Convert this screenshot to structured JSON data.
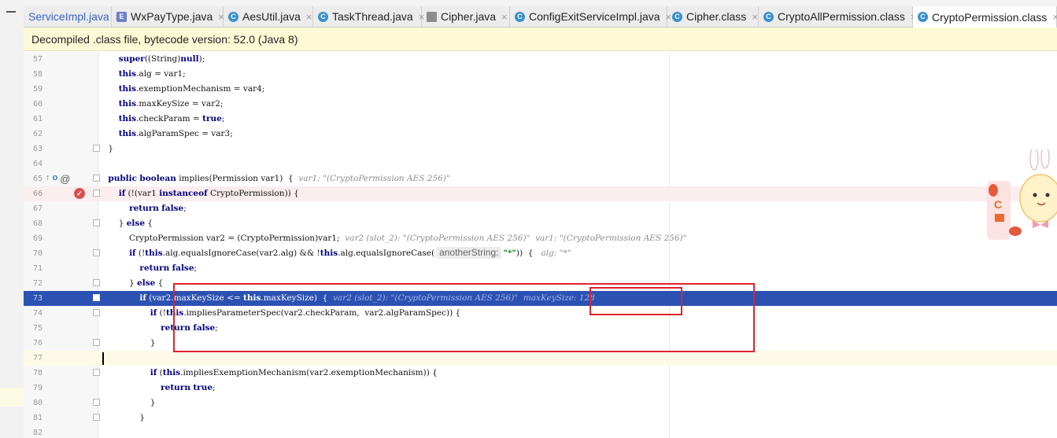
{
  "tabs": [
    {
      "label": "ServiceImpl.java",
      "icon": "c",
      "active": false,
      "blue": true
    },
    {
      "label": "WxPayType.java",
      "icon": "e",
      "active": false
    },
    {
      "label": "AesUtil.java",
      "icon": "c",
      "active": false
    },
    {
      "label": "TaskThread.java",
      "icon": "c",
      "active": false
    },
    {
      "label": "Cipher.java",
      "icon": "doc",
      "active": false
    },
    {
      "label": "ConfigExitServiceImpl.java",
      "icon": "c",
      "active": false
    },
    {
      "label": "Cipher.class",
      "icon": "c",
      "active": false
    },
    {
      "label": "CryptoAllPermission.class",
      "icon": "c",
      "active": false
    },
    {
      "label": "CryptoPermission.class",
      "icon": "c",
      "active": true
    }
  ],
  "tab_close_glyph": "×",
  "banner": "Decompiled .class file, bytecode version: 52.0 (Java 8)",
  "gutter_icons": {
    "up": "↑",
    "override": "o",
    "at": "@",
    "breakpoint": "✓"
  },
  "lines": [
    {
      "n": "57",
      "tokens": [
        {
          "t": "        "
        },
        {
          "t": "super",
          "k": "kw"
        },
        {
          "t": "((String)"
        },
        {
          "t": "null",
          "k": "kw"
        },
        {
          "t": ");"
        }
      ]
    },
    {
      "n": "58",
      "tokens": [
        {
          "t": "        "
        },
        {
          "t": "this",
          "k": "kw"
        },
        {
          "t": ".alg = var1;"
        }
      ]
    },
    {
      "n": "59",
      "tokens": [
        {
          "t": "        "
        },
        {
          "t": "this",
          "k": "kw"
        },
        {
          "t": ".exemptionMechanism = var4;"
        }
      ]
    },
    {
      "n": "60",
      "tokens": [
        {
          "t": "        "
        },
        {
          "t": "this",
          "k": "kw"
        },
        {
          "t": ".maxKeySize = var2;"
        }
      ]
    },
    {
      "n": "61",
      "tokens": [
        {
          "t": "        "
        },
        {
          "t": "this",
          "k": "kw"
        },
        {
          "t": ".checkParam = "
        },
        {
          "t": "true",
          "k": "kw"
        },
        {
          "t": ";"
        }
      ]
    },
    {
      "n": "62",
      "tokens": [
        {
          "t": "        "
        },
        {
          "t": "this",
          "k": "kw"
        },
        {
          "t": ".algParamSpec = var3;"
        }
      ]
    },
    {
      "n": "63",
      "tokens": [
        {
          "t": "    }"
        }
      ],
      "fold": true
    },
    {
      "n": "64",
      "tokens": []
    },
    {
      "n": "65",
      "tokens": [
        {
          "t": "    "
        },
        {
          "t": "public",
          "k": "kw"
        },
        {
          "t": " "
        },
        {
          "t": "boolean",
          "k": "kw"
        },
        {
          "t": " implies(Permission var1)  {  "
        },
        {
          "t": "var1: \"(CryptoPermission AES 256)\"",
          "k": "hint"
        }
      ],
      "fold": true,
      "icons": true
    },
    {
      "n": "66",
      "tokens": [
        {
          "t": "        "
        },
        {
          "t": "if",
          "k": "kw"
        },
        {
          "t": " (!(var1 "
        },
        {
          "t": "instanceof",
          "k": "kw"
        },
        {
          "t": " CryptoPermission)) {"
        }
      ],
      "fold": true,
      "bp": true
    },
    {
      "n": "67",
      "tokens": [
        {
          "t": "            "
        },
        {
          "t": "return",
          "k": "kw"
        },
        {
          "t": " "
        },
        {
          "t": "false",
          "k": "kw"
        },
        {
          "t": ";"
        }
      ]
    },
    {
      "n": "68",
      "tokens": [
        {
          "t": "        } "
        },
        {
          "t": "else",
          "k": "kw"
        },
        {
          "t": " {"
        }
      ],
      "fold": true
    },
    {
      "n": "69",
      "tokens": [
        {
          "t": "            CryptoPermission var2 = (CryptoPermission)var1;  "
        },
        {
          "t": "var2 (slot_2): \"(CryptoPermission AES 256)\"  var1: \"(CryptoPermission AES 256)\"",
          "k": "hint"
        }
      ]
    },
    {
      "n": "70",
      "tokens": [
        {
          "t": "            "
        },
        {
          "t": "if",
          "k": "kw"
        },
        {
          "t": " (!"
        },
        {
          "t": "this",
          "k": "kw"
        },
        {
          "t": ".alg.equalsIgnoreCase(var2.alg) && !"
        },
        {
          "t": "this",
          "k": "kw"
        },
        {
          "t": ".alg.equalsIgnoreCase("
        },
        {
          "t": "anotherString:",
          "k": "pbox"
        },
        {
          "t": "\"*\"",
          "k": "str"
        },
        {
          "t": "))  {   "
        },
        {
          "t": "alg: \"*\"",
          "k": "hint"
        }
      ],
      "fold": true
    },
    {
      "n": "71",
      "tokens": [
        {
          "t": "                "
        },
        {
          "t": "return",
          "k": "kw"
        },
        {
          "t": " "
        },
        {
          "t": "false",
          "k": "kw"
        },
        {
          "t": ";"
        }
      ]
    },
    {
      "n": "72",
      "tokens": [
        {
          "t": "            } "
        },
        {
          "t": "else",
          "k": "kw"
        },
        {
          "t": " {"
        }
      ],
      "fold": true
    },
    {
      "n": "73",
      "tokens": [
        {
          "t": "                "
        },
        {
          "t": "if",
          "k": "kw"
        },
        {
          "t": " (var2.maxKeySize <= "
        },
        {
          "t": "this",
          "k": "kw"
        },
        {
          "t": ".maxKeySize)  {  "
        },
        {
          "t": "var2 (slot_2): \"(CryptoPermission AES 256)\"  maxKeySize: 128",
          "k": "hint"
        }
      ],
      "fold": true,
      "sel": true
    },
    {
      "n": "74",
      "tokens": [
        {
          "t": "                    "
        },
        {
          "t": "if",
          "k": "kw"
        },
        {
          "t": " (!"
        },
        {
          "t": "this",
          "k": "kw"
        },
        {
          "t": ".impliesParameterSpec(var2.checkParam,  var2.algParamSpec)) {"
        }
      ],
      "fold": true
    },
    {
      "n": "75",
      "tokens": [
        {
          "t": "                        "
        },
        {
          "t": "return",
          "k": "kw"
        },
        {
          "t": " "
        },
        {
          "t": "false",
          "k": "kw"
        },
        {
          "t": ";"
        }
      ]
    },
    {
      "n": "76",
      "tokens": [
        {
          "t": "                    }"
        }
      ],
      "fold": true
    },
    {
      "n": "77",
      "tokens": [],
      "cur": true
    },
    {
      "n": "78",
      "tokens": [
        {
          "t": "                    "
        },
        {
          "t": "if",
          "k": "kw"
        },
        {
          "t": " ("
        },
        {
          "t": "this",
          "k": "kw"
        },
        {
          "t": ".impliesExemptionMechanism(var2.exemptionMechanism)) {"
        }
      ],
      "fold": true
    },
    {
      "n": "79",
      "tokens": [
        {
          "t": "                        "
        },
        {
          "t": "return",
          "k": "kw"
        },
        {
          "t": " "
        },
        {
          "t": "true",
          "k": "kw"
        },
        {
          "t": ";"
        }
      ]
    },
    {
      "n": "80",
      "tokens": [
        {
          "t": "                    }"
        }
      ],
      "fold": true
    },
    {
      "n": "81",
      "tokens": [
        {
          "t": "                }"
        }
      ],
      "fold": true
    },
    {
      "n": "82",
      "tokens": []
    }
  ],
  "deco": {
    "badge_letter": "C"
  }
}
